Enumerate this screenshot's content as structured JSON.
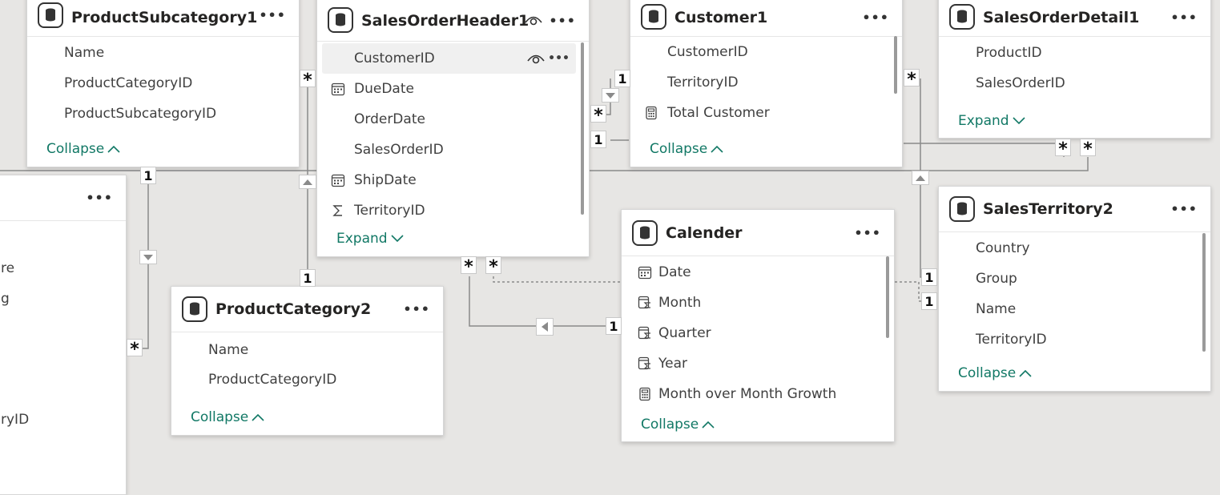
{
  "tables": {
    "product_subcategory1": {
      "title": "ProductSubcategory1",
      "fields": [
        "Name",
        "ProductCategoryID",
        "ProductSubcategoryID"
      ],
      "toggle": "Collapse"
    },
    "sales_order_header1": {
      "title": "SalesOrderHeader1",
      "fields": [
        "CustomerID",
        "DueDate",
        "OrderDate",
        "SalesOrderID",
        "ShipDate",
        "TerritoryID"
      ],
      "toggle": "Expand"
    },
    "customer1": {
      "title": "Customer1",
      "fields": [
        "CustomerID",
        "TerritoryID",
        "Total Customer"
      ],
      "toggle": "Collapse"
    },
    "sales_order_detail1": {
      "title": "SalesOrderDetail1",
      "fields": [
        "ProductID",
        "SalesOrderID"
      ],
      "toggle": "Expand"
    },
    "sales_territory2": {
      "title": "SalesTerritory2",
      "fields": [
        "Country",
        "Group",
        "Name",
        "TerritoryID"
      ],
      "toggle": "Collapse"
    },
    "calender": {
      "title": "Calender",
      "fields": [
        "Date",
        "Month",
        "Quarter",
        "Year",
        "Month over Month Growth"
      ],
      "toggle": "Collapse"
    },
    "product_category2": {
      "title": "ProductCategory2",
      "fields": [
        "Name",
        "ProductCategoryID"
      ],
      "toggle": "Collapse"
    },
    "left_partial": {
      "title": "",
      "fields": [
        "re",
        "g",
        "ryID"
      ]
    }
  },
  "cardinality": {
    "one": "1",
    "many": "*"
  },
  "icons": {
    "table": "table-icon",
    "date": "calendar-icon",
    "measure": "calculator-icon",
    "sum": "sigma-icon",
    "hierarchy": "hierarchy-icon",
    "visibility": "eye-icon",
    "more": "more-options-icon"
  },
  "colors": {
    "canvas": "#e7e6e4",
    "link": "#117865",
    "line": "#8a8a8a"
  }
}
